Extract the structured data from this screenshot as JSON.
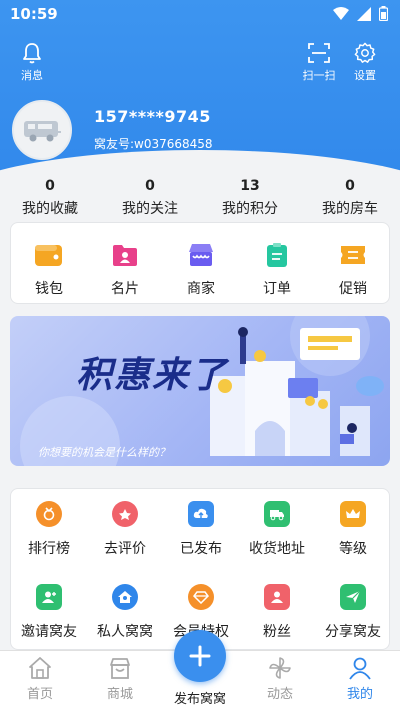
{
  "status_bar": {
    "time": "10:59"
  },
  "header": {
    "messages_label": "消息",
    "scan_label": "扫一扫",
    "settings_label": "设置",
    "accent_color": "#2f86ea"
  },
  "profile": {
    "phone": "157****9745",
    "user_id": "窝友号:w037668458"
  },
  "stats": [
    {
      "value": "0",
      "label": "我的收藏"
    },
    {
      "value": "0",
      "label": "我的关注"
    },
    {
      "value": "13",
      "label": "我的积分"
    },
    {
      "value": "0",
      "label": "我的房车"
    }
  ],
  "wallet_menu": [
    {
      "label": "钱包",
      "icon": "wallet-icon",
      "color": "#f5a623"
    },
    {
      "label": "名片",
      "icon": "card-icon",
      "color": "#e8408a"
    },
    {
      "label": "商家",
      "icon": "store-icon",
      "color": "#6a5cf0"
    },
    {
      "label": "订单",
      "icon": "order-icon",
      "color": "#25c7a0"
    },
    {
      "label": "促销",
      "icon": "coupon-icon",
      "color": "#f5a623"
    }
  ],
  "banner": {
    "title": "积惠来了",
    "subtitle": "你想要的机会是什么样的？"
  },
  "tools": [
    {
      "label": "排行榜",
      "icon": "ranking-icon",
      "color": "#f5902a"
    },
    {
      "label": "去评价",
      "icon": "review-icon",
      "color": "#f0626a"
    },
    {
      "label": "已发布",
      "icon": "cloud-upload-icon",
      "color": "#3a8fee"
    },
    {
      "label": "收货地址",
      "icon": "truck-icon",
      "color": "#2fbf71"
    },
    {
      "label": "等级",
      "icon": "crown-icon",
      "color": "#f5a623"
    },
    {
      "label": "邀请窝友",
      "icon": "invite-user-icon",
      "color": "#2fbf71"
    },
    {
      "label": "私人窝窝",
      "icon": "home-user-icon",
      "color": "#2f86ea"
    },
    {
      "label": "会员特权",
      "icon": "diamond-icon",
      "color": "#f5902a"
    },
    {
      "label": "粉丝",
      "icon": "fans-icon",
      "color": "#f0626a"
    },
    {
      "label": "分享窝友",
      "icon": "share-icon",
      "color": "#2fbf71"
    }
  ],
  "tabbar": {
    "home": "首页",
    "mall": "商城",
    "publish": "发布窝窝",
    "feed": "动态",
    "mine": "我的"
  }
}
